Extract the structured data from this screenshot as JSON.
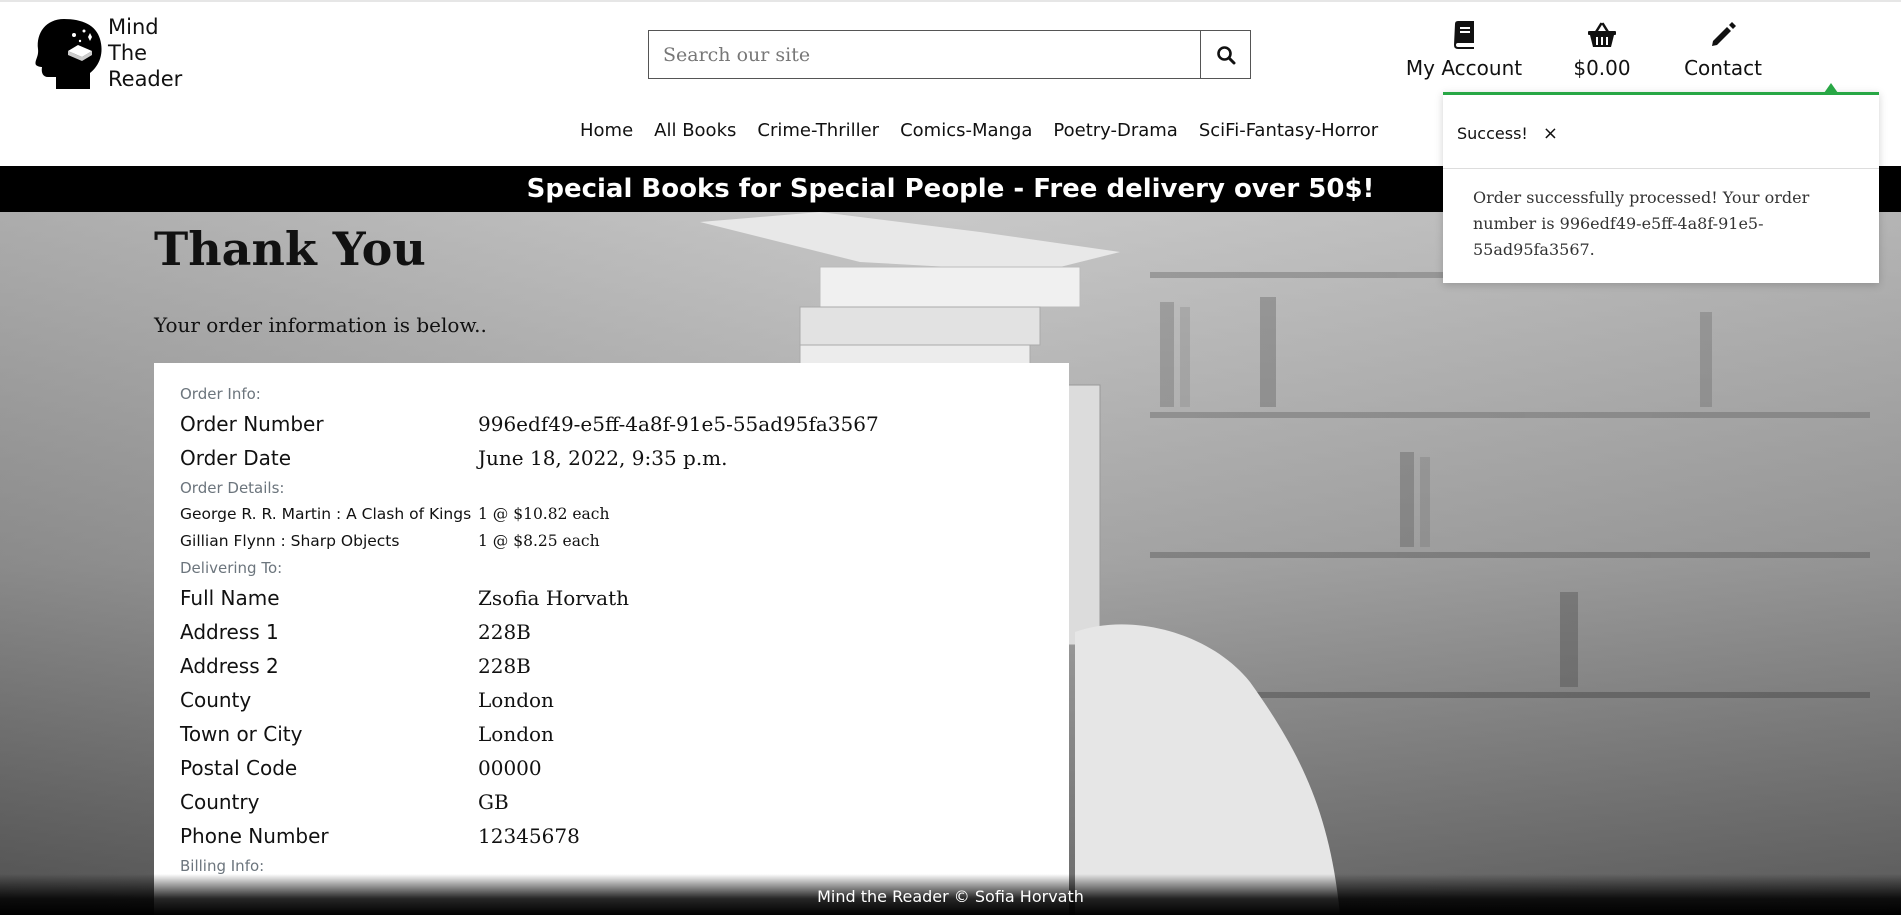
{
  "logo": {
    "line1": "Mind",
    "line2": "The",
    "line3": "Reader"
  },
  "search": {
    "placeholder": "Search our site"
  },
  "account": {
    "my_account_label": "My Account",
    "basket_total": "$0.00",
    "contact_label": "Contact"
  },
  "nav": {
    "items": [
      "Home",
      "All Books",
      "Crime-Thriller",
      "Comics-Manga",
      "Poetry-Drama",
      "SciFi-Fantasy-Horror"
    ]
  },
  "banner": {
    "text": "Special Books for Special People - Free delivery over 50$!"
  },
  "page": {
    "title": "Thank You",
    "subtitle": "Your order information is below.."
  },
  "order": {
    "info_label": "Order Info:",
    "number_label": "Order Number",
    "number": "996edf49-e5ff-4a8f-91e5-55ad95fa3567",
    "date_label": "Order Date",
    "date": "June 18, 2022, 9:35 p.m.",
    "details_label": "Order Details:",
    "items": [
      {
        "name": "George R. R. Martin : A Clash of Kings",
        "qty": "1 @ $10.82 each"
      },
      {
        "name": "Gillian Flynn : Sharp Objects",
        "qty": "1 @ $8.25 each"
      }
    ],
    "delivery_label": "Delivering To:",
    "delivery": [
      {
        "label": "Full Name",
        "value": "Zsofia Horvath"
      },
      {
        "label": "Address 1",
        "value": "228B"
      },
      {
        "label": "Address 2",
        "value": "228B"
      },
      {
        "label": "County",
        "value": "London"
      },
      {
        "label": "Town or City",
        "value": "London"
      },
      {
        "label": "Postal Code",
        "value": "00000"
      },
      {
        "label": "Country",
        "value": "GB"
      },
      {
        "label": "Phone Number",
        "value": "12345678"
      }
    ],
    "billing_label": "Billing Info:"
  },
  "footer": {
    "text": "Mind the Reader © Sofia Horvath"
  },
  "toast": {
    "title": "Success!",
    "close": "×",
    "message": "Order successfully processed! Your order number is 996edf49-e5ff-4a8f-91e5-55ad95fa3567."
  },
  "colors": {
    "success": "#28a745",
    "banner": "#000000"
  },
  "icons": [
    "head-book-logo",
    "search-icon",
    "book-icon",
    "basket-icon",
    "pencil-icon",
    "close-icon"
  ]
}
